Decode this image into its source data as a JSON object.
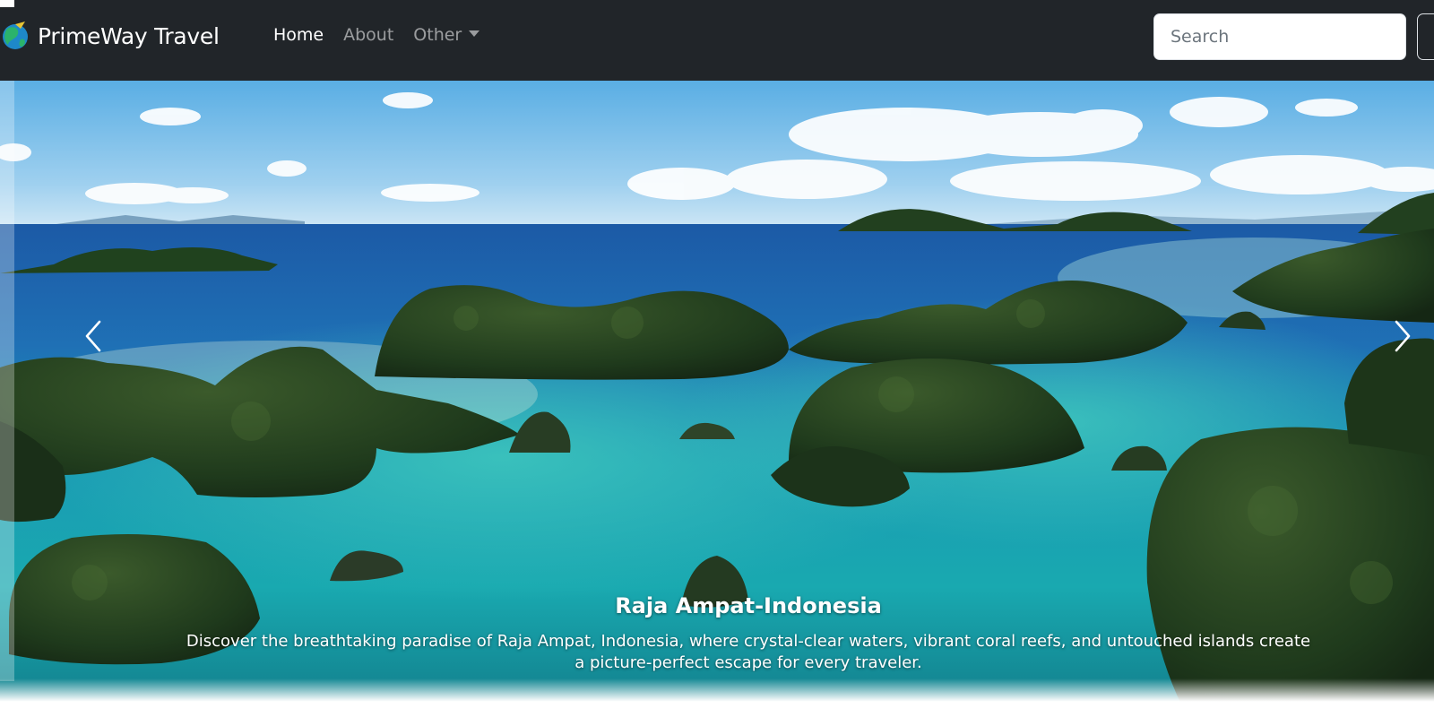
{
  "navbar": {
    "brand": "PrimeWay Travel",
    "links": [
      {
        "label": "Home",
        "active": true
      },
      {
        "label": "About",
        "active": false
      },
      {
        "label": "Other",
        "active": false,
        "dropdown": true
      }
    ],
    "search": {
      "placeholder": "Search",
      "value": ""
    },
    "icons": {
      "logo": "globe-logo",
      "dropdown": "caret-down-icon"
    }
  },
  "carousel": {
    "caption_title": "Raja Ampat-Indonesia",
    "caption_text": "Discover the breathtaking paradise of Raja Ampat, Indonesia, where crystal-clear waters, vibrant coral reefs, and untouched islands create a picture-perfect escape for every traveler.",
    "controls": {
      "prev_icon": "chevron-left-icon",
      "next_icon": "chevron-right-icon"
    }
  },
  "colors": {
    "navbar_bg": "#212529",
    "text_active": "#ffffff",
    "text_muted": "rgba(255,255,255,0.55)",
    "sea_deep": "#1f63a8",
    "sea_turquoise": "#1aa6b5",
    "island_green": "#1f3b1f"
  }
}
